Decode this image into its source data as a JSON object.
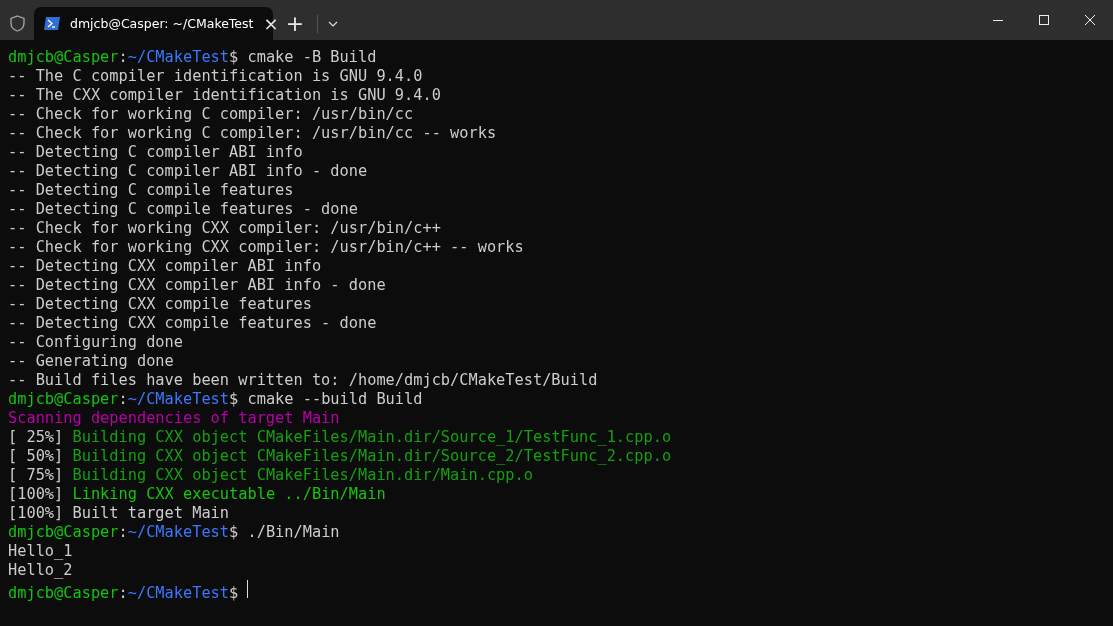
{
  "window": {
    "tab": {
      "title": "dmjcb@Casper: ~/CMakeTest",
      "close": "×",
      "selected": true
    },
    "new_tab": "+"
  },
  "terminal": {
    "lines": [
      [
        {
          "text": "dmjcb@Casper",
          "kind": "user"
        },
        {
          "text": ":",
          "kind": "plain"
        },
        {
          "text": "~/CMakeTest",
          "kind": "path"
        },
        {
          "text": "$ cmake -B Build",
          "kind": "plain"
        }
      ],
      [
        {
          "text": "-- The C compiler identification is GNU 9.4.0",
          "kind": "plain"
        }
      ],
      [
        {
          "text": "-- The CXX compiler identification is GNU 9.4.0",
          "kind": "plain"
        }
      ],
      [
        {
          "text": "-- Check for working C compiler: /usr/bin/cc",
          "kind": "plain"
        }
      ],
      [
        {
          "text": "-- Check for working C compiler: /usr/bin/cc -- works",
          "kind": "plain"
        }
      ],
      [
        {
          "text": "-- Detecting C compiler ABI info",
          "kind": "plain"
        }
      ],
      [
        {
          "text": "-- Detecting C compiler ABI info - done",
          "kind": "plain"
        }
      ],
      [
        {
          "text": "-- Detecting C compile features",
          "kind": "plain"
        }
      ],
      [
        {
          "text": "-- Detecting C compile features - done",
          "kind": "plain"
        }
      ],
      [
        {
          "text": "-- Check for working CXX compiler: /usr/bin/c++",
          "kind": "plain"
        }
      ],
      [
        {
          "text": "-- Check for working CXX compiler: /usr/bin/c++ -- works",
          "kind": "plain"
        }
      ],
      [
        {
          "text": "-- Detecting CXX compiler ABI info",
          "kind": "plain"
        }
      ],
      [
        {
          "text": "-- Detecting CXX compiler ABI info - done",
          "kind": "plain"
        }
      ],
      [
        {
          "text": "-- Detecting CXX compile features",
          "kind": "plain"
        }
      ],
      [
        {
          "text": "-- Detecting CXX compile features - done",
          "kind": "plain"
        }
      ],
      [
        {
          "text": "-- Configuring done",
          "kind": "plain"
        }
      ],
      [
        {
          "text": "-- Generating done",
          "kind": "plain"
        }
      ],
      [
        {
          "text": "-- Build files have been written to: /home/dmjcb/CMakeTest/Build",
          "kind": "plain"
        }
      ],
      [
        {
          "text": "dmjcb@Casper",
          "kind": "user"
        },
        {
          "text": ":",
          "kind": "plain"
        },
        {
          "text": "~/CMakeTest",
          "kind": "path"
        },
        {
          "text": "$ cmake --build Build",
          "kind": "plain"
        }
      ],
      [
        {
          "text": "Scanning dependencies of target Main",
          "kind": "magenta"
        }
      ],
      [
        {
          "text": "[ 25%]",
          "kind": "plain"
        },
        {
          "text": "Building CXX object CMakeFiles/Main.dir/Source_1/TestFunc_1.cpp.o",
          "kind": "green"
        }
      ],
      [
        {
          "text": "[ 50%]",
          "kind": "plain"
        },
        {
          "text": "Building CXX object CMakeFiles/Main.dir/Source_2/TestFunc_2.cpp.o",
          "kind": "green"
        }
      ],
      [
        {
          "text": "[ 75%]",
          "kind": "plain"
        },
        {
          "text": "Building CXX object CMakeFiles/Main.dir/Main.cpp.o",
          "kind": "green"
        }
      ],
      [
        {
          "text": "[100%]",
          "kind": "plain"
        },
        {
          "text": "Linking CXX executable ../Bin/Main",
          "kind": "bright"
        }
      ],
      [
        {
          "text": "[100%] Built target Main",
          "kind": "plain"
        }
      ],
      [
        {
          "text": "dmjcb@Casper",
          "kind": "user"
        },
        {
          "text": ":",
          "kind": "plain"
        },
        {
          "text": "~/CMakeTest",
          "kind": "path"
        },
        {
          "text": "$ ./Bin/Main",
          "kind": "plain"
        }
      ],
      [
        {
          "text": "Hello_1",
          "kind": "plain"
        }
      ],
      [
        {
          "text": "Hello_2",
          "kind": "plain"
        }
      ],
      [
        {
          "text": "dmjcb@Casper",
          "kind": "user"
        },
        {
          "text": ":",
          "kind": "plain"
        },
        {
          "text": "~/CMakeTest",
          "kind": "path"
        },
        {
          "text": "$",
          "kind": "plain"
        },
        {
          "kind": "cursor"
        }
      ]
    ]
  }
}
